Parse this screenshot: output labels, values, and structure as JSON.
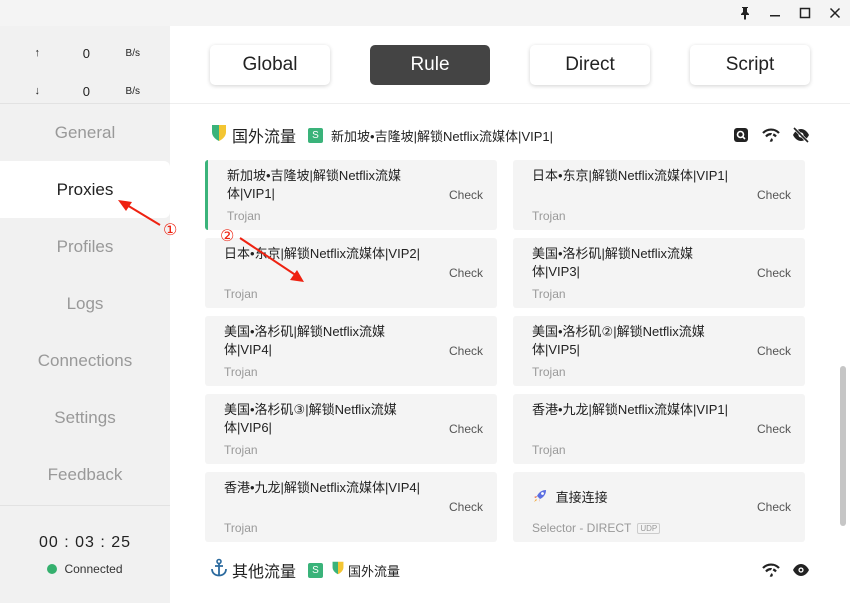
{
  "window": {
    "pin_icon": "pin-icon",
    "min_icon": "minimize-icon",
    "max_icon": "maximize-icon",
    "close_icon": "close-icon"
  },
  "traffic": {
    "up": {
      "arrow": "↑",
      "value": "0",
      "unit": "B/s"
    },
    "down": {
      "arrow": "↓",
      "value": "0",
      "unit": "B/s"
    }
  },
  "nav": [
    "General",
    "Proxies",
    "Profiles",
    "Logs",
    "Connections",
    "Settings",
    "Feedback"
  ],
  "status": {
    "clock": "00 : 03 : 25",
    "label": "Connected",
    "color": "#35b06e"
  },
  "modes": [
    "Global",
    "Rule",
    "Direct",
    "Script"
  ],
  "groups": [
    {
      "title": "国外流量",
      "badge": "S",
      "selected": "新加坡•吉隆坡|解锁Netflix流媒体|VIP1|"
    },
    {
      "title": "其他流量",
      "badge": "S",
      "selected": "国外流量"
    }
  ],
  "proxies": [
    {
      "name": "新加坡•吉隆坡|解锁Netflix流媒体|VIP1|",
      "type": "Trojan",
      "check": "Check"
    },
    {
      "name": "日本•东京|解锁Netflix流媒体|VIP1|",
      "type": "Trojan",
      "check": "Check"
    },
    {
      "name": "日本•东京|解锁Netflix流媒体|VIP2|",
      "type": "Trojan",
      "check": "Check"
    },
    {
      "name": "美国•洛杉矶|解锁Netflix流媒体|VIP3|",
      "type": "Trojan",
      "check": "Check"
    },
    {
      "name": "美国•洛杉矶|解锁Netflix流媒体|VIP4|",
      "type": "Trojan",
      "check": "Check"
    },
    {
      "name": "美国•洛杉矶②|解锁Netflix流媒体|VIP5|",
      "type": "Trojan",
      "check": "Check"
    },
    {
      "name": "美国•洛杉矶③|解锁Netflix流媒体|VIP6|",
      "type": "Trojan",
      "check": "Check"
    },
    {
      "name": "香港•九龙|解锁Netflix流媒体|VIP1|",
      "type": "Trojan",
      "check": "Check"
    },
    {
      "name": "香港•九龙|解锁Netflix流媒体|VIP4|",
      "type": "Trojan",
      "check": "Check"
    },
    {
      "name": "直接连接",
      "type": "Selector - DIRECT",
      "udp": "UDP",
      "check": "Check"
    }
  ],
  "annotations": [
    "①",
    "②"
  ],
  "accent": "#3ab37a"
}
